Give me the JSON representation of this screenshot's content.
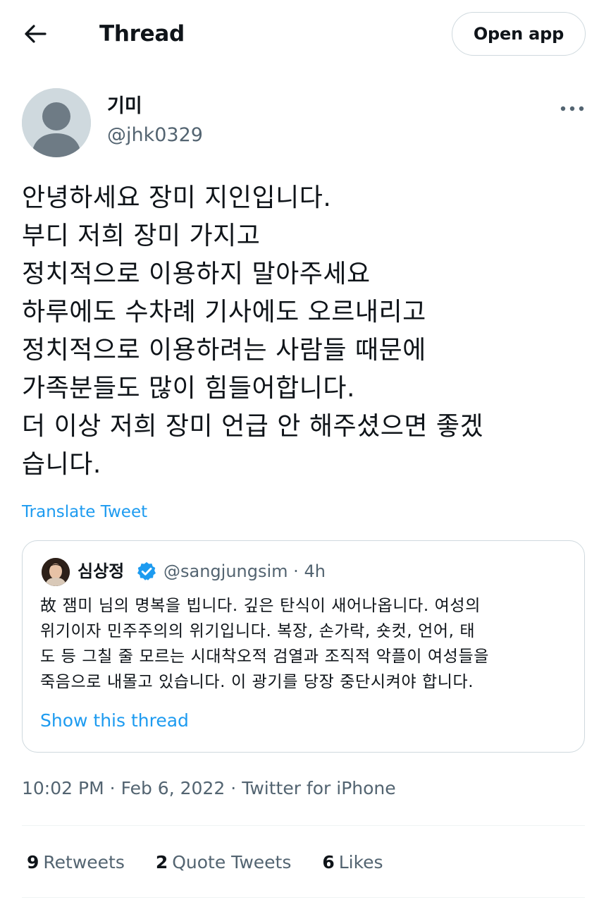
{
  "header": {
    "title": "Thread",
    "open_app_label": "Open app",
    "back_icon": "arrow-left-icon"
  },
  "author": {
    "name": "기미",
    "handle": "@jhk0329",
    "avatar": "default-avatar-icon",
    "more_icon": "more-dots-icon"
  },
  "tweet": {
    "lines": [
      "안녕하세요 장미 지인입니다.",
      "부디 저희 장미 가지고",
      "정치적으로 이용하지 말아주세요",
      "하루에도 수차례 기사에도 오르내리고",
      "정치적으로 이용하려는 사람들 때문에",
      "가족분들도 많이 힘들어합니다.",
      "더 이상 저희 장미 언급 안 해주셨으면 좋겠",
      "습니다."
    ],
    "translate_label": "Translate Tweet"
  },
  "quote": {
    "name": "심상정",
    "verified_icon": "verified-badge-icon",
    "handle": "@sangjungsim",
    "dot": "·",
    "time": "4h",
    "lines": [
      "故 잼미 님의 명복을 빕니다. 깊은 탄식이 새어나옵니다. 여성의",
      "위기이자 민주주의의 위기입니다. 복장, 손가락, 숏컷, 언어, 태",
      "도 등 그칠 줄 모르는 시대착오적 검열과 조직적 악플이 여성들을",
      "죽음으로 내몰고 있습니다. 이 광기를 당장 중단시켜야 합니다."
    ],
    "show_thread_label": "Show this thread"
  },
  "meta": {
    "time": "10:02 PM",
    "sep": "·",
    "date": "Feb 6, 2022",
    "source": "Twitter for iPhone"
  },
  "stats": {
    "retweets_count": "9",
    "retweets_label": "Retweets",
    "quotes_count": "2",
    "quotes_label": "Quote Tweets",
    "likes_count": "6",
    "likes_label": "Likes"
  },
  "colors": {
    "link": "#1d9bf0",
    "secondary_text": "#536471",
    "border": "#cfd9de",
    "divider": "#eff3f4"
  }
}
